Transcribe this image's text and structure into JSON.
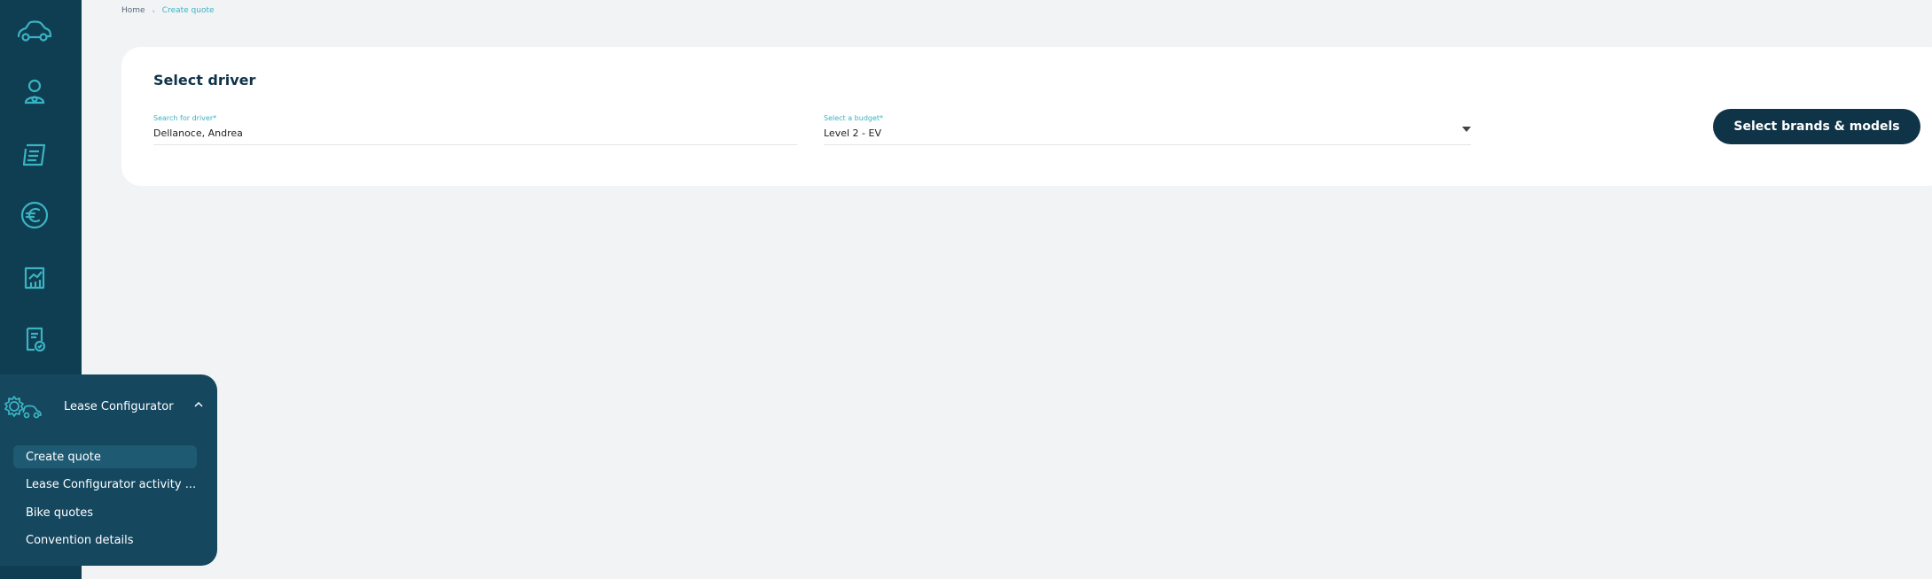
{
  "breadcrumb": {
    "home": "Home",
    "separator": "›",
    "current": "Create quote"
  },
  "card": {
    "title": "Select driver",
    "driver_field": {
      "label": "Search for driver*",
      "value": "Dellanoce, Andrea"
    },
    "budget_field": {
      "label": "Select a budget*",
      "value": "Level 2 - EV"
    },
    "button_label": "Select brands & models"
  },
  "sidebar": {
    "icons": [
      "car-icon",
      "driver-icon",
      "document-icon",
      "euro-icon",
      "report-chart-icon",
      "shield-document-icon"
    ]
  },
  "flyout": {
    "title": "Lease Configurator",
    "items": [
      {
        "label": "Create quote"
      },
      {
        "label": "Lease Configurator activity ..."
      },
      {
        "label": "Bike quotes"
      },
      {
        "label": "Convention details"
      }
    ]
  },
  "colors": {
    "sidebar": "#0f3e52",
    "accent": "#3ab3c2",
    "primary_button": "#0f3347"
  }
}
